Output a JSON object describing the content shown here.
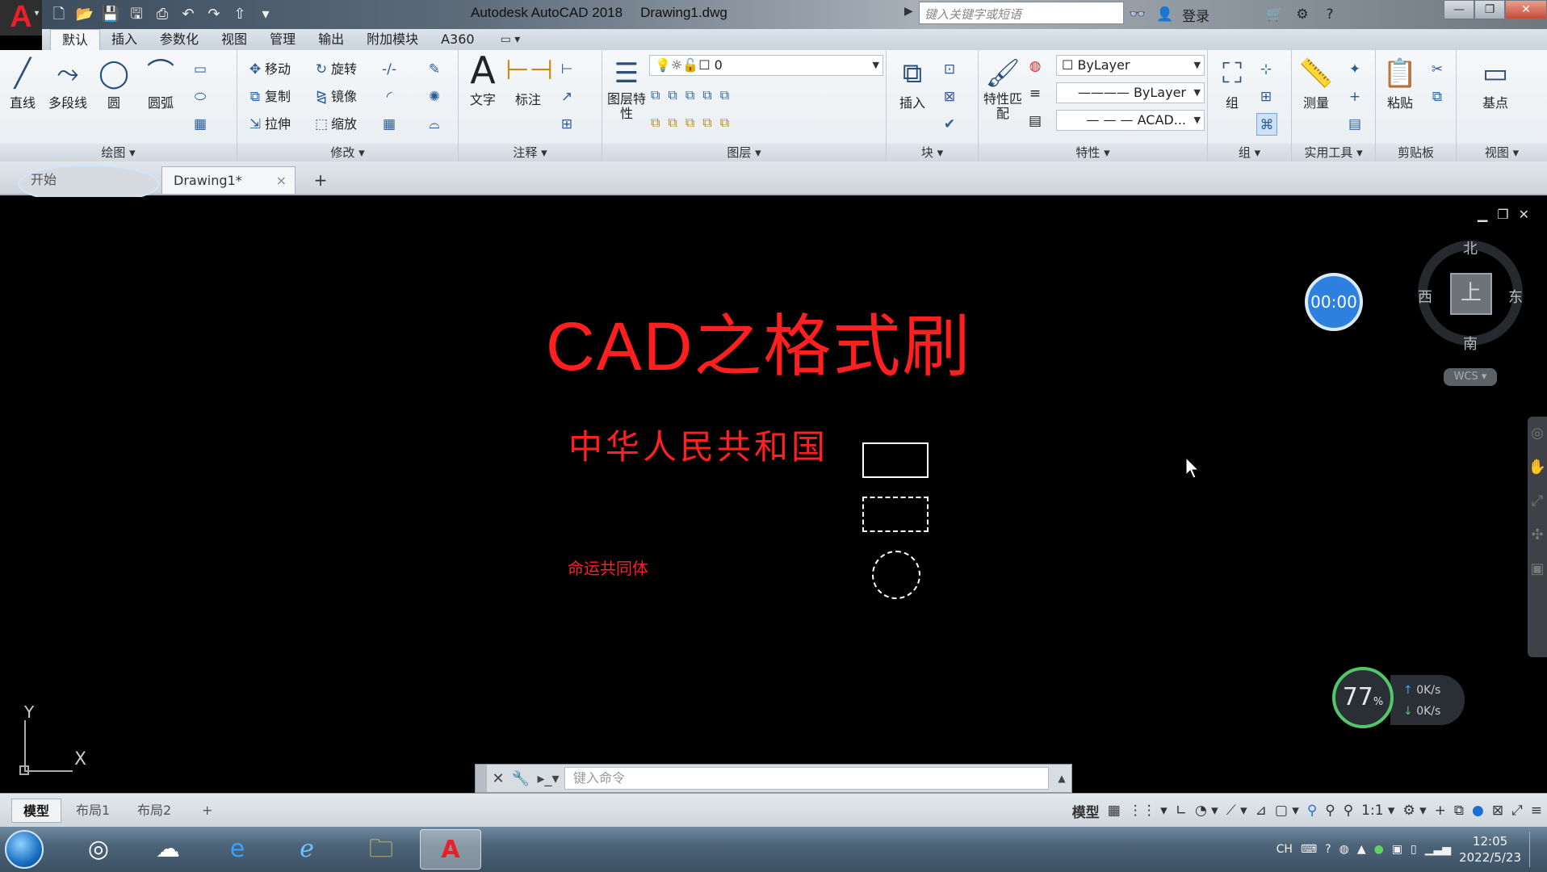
{
  "window": {
    "app_name": "Autodesk AutoCAD 2018",
    "file_name": "Drawing1.dwg",
    "search_placeholder": "键入关键字或短语",
    "login": "登录",
    "app_letter": "A"
  },
  "ribbon_tabs": [
    "默认",
    "插入",
    "参数化",
    "视图",
    "管理",
    "输出",
    "附加模块",
    "A360"
  ],
  "ribbon_tab_ext": "▭ ▾",
  "panels": {
    "draw": {
      "label": "绘图 ▾",
      "line": "直线",
      "polyline": "多段线",
      "circle": "圆",
      "arc": "圆弧"
    },
    "modify": {
      "label": "修改 ▾",
      "move": "移动",
      "rotate": "旋转",
      "copy": "复制",
      "mirror": "镜像",
      "stretch": "拉伸",
      "scale": "缩放"
    },
    "annotation": {
      "label": "注释 ▾",
      "text": "文字",
      "dimension": "标注"
    },
    "layers": {
      "label": "图层 ▾",
      "layer_props": "图层特性",
      "layer_value": "0"
    },
    "block": {
      "label": "块 ▾",
      "insert": "插入"
    },
    "properties": {
      "label": "特性 ▾",
      "match": "特性匹配",
      "color": "ByLayer",
      "linetype": "ByLayer",
      "lineweight": "ACAD..."
    },
    "groups": {
      "label": "组 ▾",
      "group": "组"
    },
    "utilities": {
      "label": "实用工具 ▾",
      "measure": "测量"
    },
    "clipboard": {
      "label": "剪贴板",
      "paste": "粘贴"
    },
    "view": {
      "label": "视图 ▾",
      "base": "基点"
    }
  },
  "doc_tabs": {
    "start": "开始",
    "active": "Drawing1*",
    "close": "×",
    "add": "+"
  },
  "canvas": {
    "title": "CAD之格式刷",
    "line1": "中华人民共和国",
    "line2": "命运共同体",
    "timer": "00:00",
    "compass": {
      "north": "北",
      "south": "南",
      "east": "东",
      "west": "西",
      "center": "上"
    },
    "wcs": "WCS ▾",
    "gauge_value": "77",
    "gauge_unit": "%",
    "net_up": "0K/s",
    "net_down": "0K/s",
    "ucs_x": "X",
    "ucs_y": "Y"
  },
  "command_line": {
    "placeholder": "键入命令"
  },
  "layout_tabs": [
    "模型",
    "布局1",
    "布局2",
    "+"
  ],
  "status": {
    "model": "模型",
    "scale": "1:1 ▾"
  },
  "taskbar": {
    "clock_time": "12:05",
    "clock_date": "2022/5/23",
    "ime": "CH"
  },
  "colors": {
    "drawing_red": "#ff1f1f",
    "timer_blue": "#2d7fe0",
    "autocad_red": "#e8202a"
  }
}
